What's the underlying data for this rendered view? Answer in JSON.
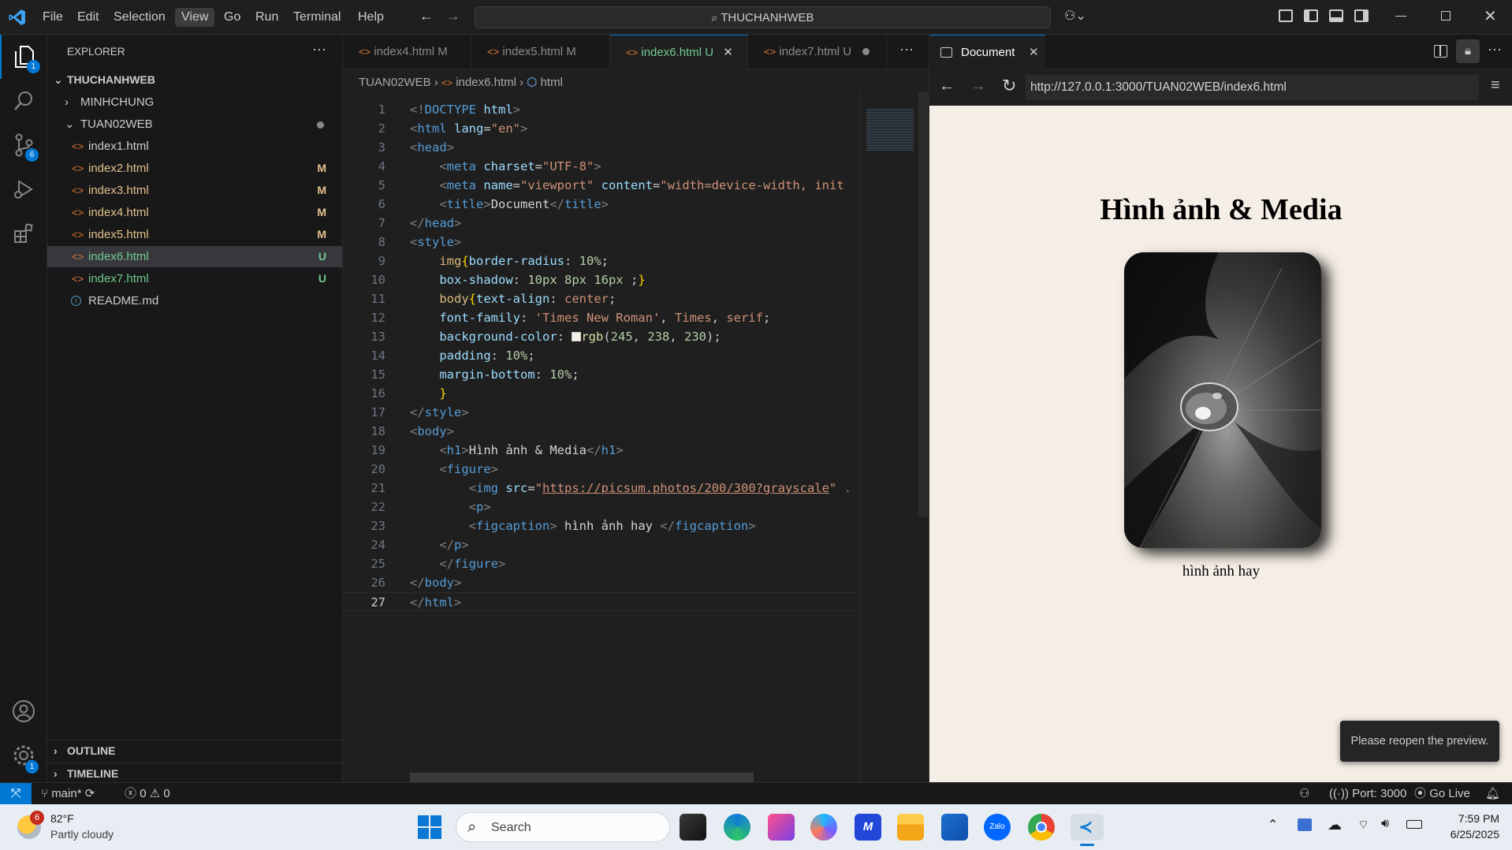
{
  "menu": [
    "File",
    "Edit",
    "Selection",
    "View",
    "Go",
    "Run",
    "Terminal",
    "Help"
  ],
  "active_menu": "View",
  "command_center": "THUCHANHWEB",
  "activity_badges": {
    "explorer": "1",
    "source_control": "6",
    "settings": "1"
  },
  "explorer": {
    "title": "EXPLORER",
    "root": "THUCHANHWEB",
    "folders": [
      "MINHCHUNG",
      "TUAN02WEB"
    ],
    "files": [
      {
        "name": "index1.html",
        "status": ""
      },
      {
        "name": "index2.html",
        "status": "M"
      },
      {
        "name": "index3.html",
        "status": "M"
      },
      {
        "name": "index4.html",
        "status": "M"
      },
      {
        "name": "index5.html",
        "status": "M"
      },
      {
        "name": "index6.html",
        "status": "U"
      },
      {
        "name": "index7.html",
        "status": "U"
      },
      {
        "name": "README.md",
        "status": ""
      }
    ],
    "outline": "OUTLINE",
    "timeline": "TIMELINE"
  },
  "tabs": [
    {
      "label": "index4.html",
      "status": "M"
    },
    {
      "label": "index5.html",
      "status": "M"
    },
    {
      "label": "index6.html",
      "status": "U"
    },
    {
      "label": "index7.html",
      "status": "U"
    }
  ],
  "breadcrumb": [
    "TUAN02WEB",
    "index6.html",
    "html"
  ],
  "code_lines": [
    "<!DOCTYPE html>",
    "<html lang=\"en\">",
    "<head>",
    "    <meta charset=\"UTF-8\">",
    "    <meta name=\"viewport\" content=\"width=device-width, init",
    "    <title>Document</title>",
    "</head>",
    "<style>",
    "    img{border-radius: 10%;",
    "    box-shadow: 10px 8px 16px ;}",
    "    body{text-align: center;",
    "    font-family: 'Times New Roman', Times, serif;",
    "    background-color: rgb(245, 238, 230);",
    "    padding: 10%;",
    "    margin-bottom: 10%;",
    "    }",
    "</style>",
    "<body>",
    "    <h1>Hình ảnh & Media</h1>",
    "    <figure>",
    "        <img src=\"https://picsum.photos/200/300?grayscale\" .",
    "        <p>",
    "        <figcaption> hình ảnh hay </figcaption>",
    "    </p>",
    "    </figure>",
    "</body>",
    "</html>"
  ],
  "preview": {
    "tab_title": "Document",
    "url": "http://127.0.0.1:3000/TUAN02WEB/index6.html",
    "heading": "Hình ảnh & Media",
    "caption": "hình ảnh hay",
    "toast": "Please reopen the preview."
  },
  "status": {
    "branch": "main*",
    "errors": "0",
    "warnings": "0",
    "port": "Port: 3000",
    "golive": "Go Live"
  },
  "taskbar": {
    "weather_badge": "6",
    "temperature": "82°F",
    "weather": "Partly cloudy",
    "search_placeholder": "Search",
    "time": "7:59 PM",
    "date": "6/25/2025"
  }
}
